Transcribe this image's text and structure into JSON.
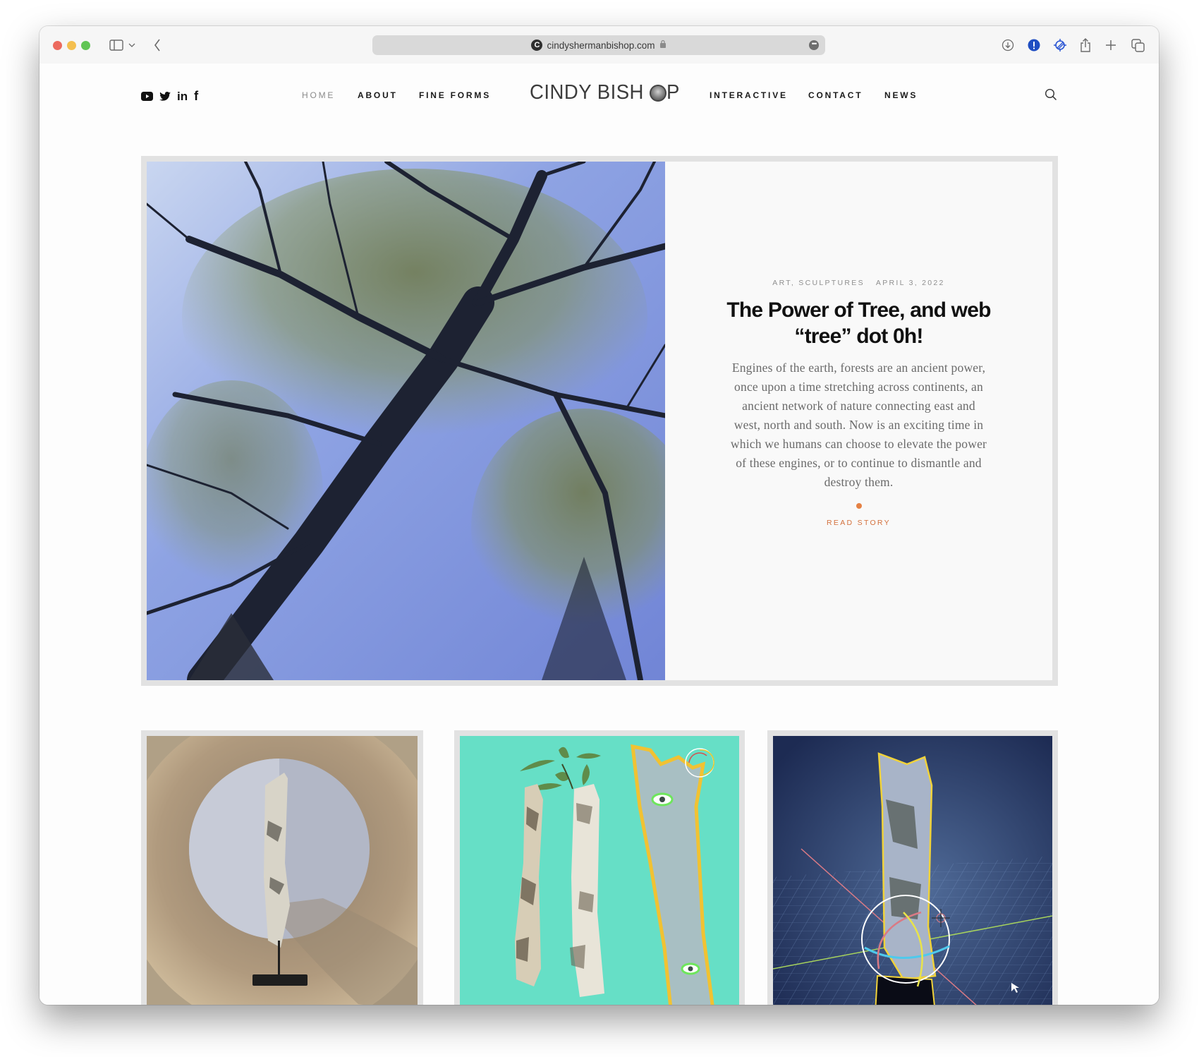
{
  "browser": {
    "url": "cindyshermanbishop.com",
    "favicon_letter": "C",
    "toolbar_icons": [
      "sidebar-icon",
      "chevron-down-icon",
      "back-icon",
      "download-icon",
      "alert-extension-icon",
      "vpn-extension-icon",
      "share-icon",
      "new-tab-icon",
      "tabs-overview-icon"
    ]
  },
  "header": {
    "social": [
      "youtube-icon",
      "twitter-icon",
      "linkedin-icon",
      "facebook-icon"
    ],
    "nav_left": [
      {
        "label": "Home",
        "active": true
      },
      {
        "label": "About",
        "active": false
      },
      {
        "label": "Fine Forms",
        "active": false
      }
    ],
    "logo": {
      "text_left": "CINDY BISH",
      "text_right": "P"
    },
    "nav_right": [
      {
        "label": "Interactive",
        "active": false
      },
      {
        "label": "Contact",
        "active": false
      },
      {
        "label": "News",
        "active": false
      }
    ]
  },
  "featured": {
    "image_alt": "Looking up at tall trees against blue sky",
    "categories": "Art, Sculptures",
    "date": "April 3, 2022",
    "title": "The Power of Tree, and web “tree” dot 0h!",
    "excerpt": "Engines of the earth, forests are an ancient power, once upon a time stretching across continents, an ancient network of nature connecting east and west, north and south. Now is an exciting time in which we humans can choose to elevate the power of these engines, or to continue to dismantle and destroy them.",
    "cta": "Read Story",
    "accent": "#d3703c"
  },
  "cards": [
    {
      "image_alt": "Birch branch sculpture inside wooden ring"
    },
    {
      "image_alt": "Birch branches collage on teal background"
    },
    {
      "image_alt": "3D scan of birch branch in modeling software"
    }
  ]
}
